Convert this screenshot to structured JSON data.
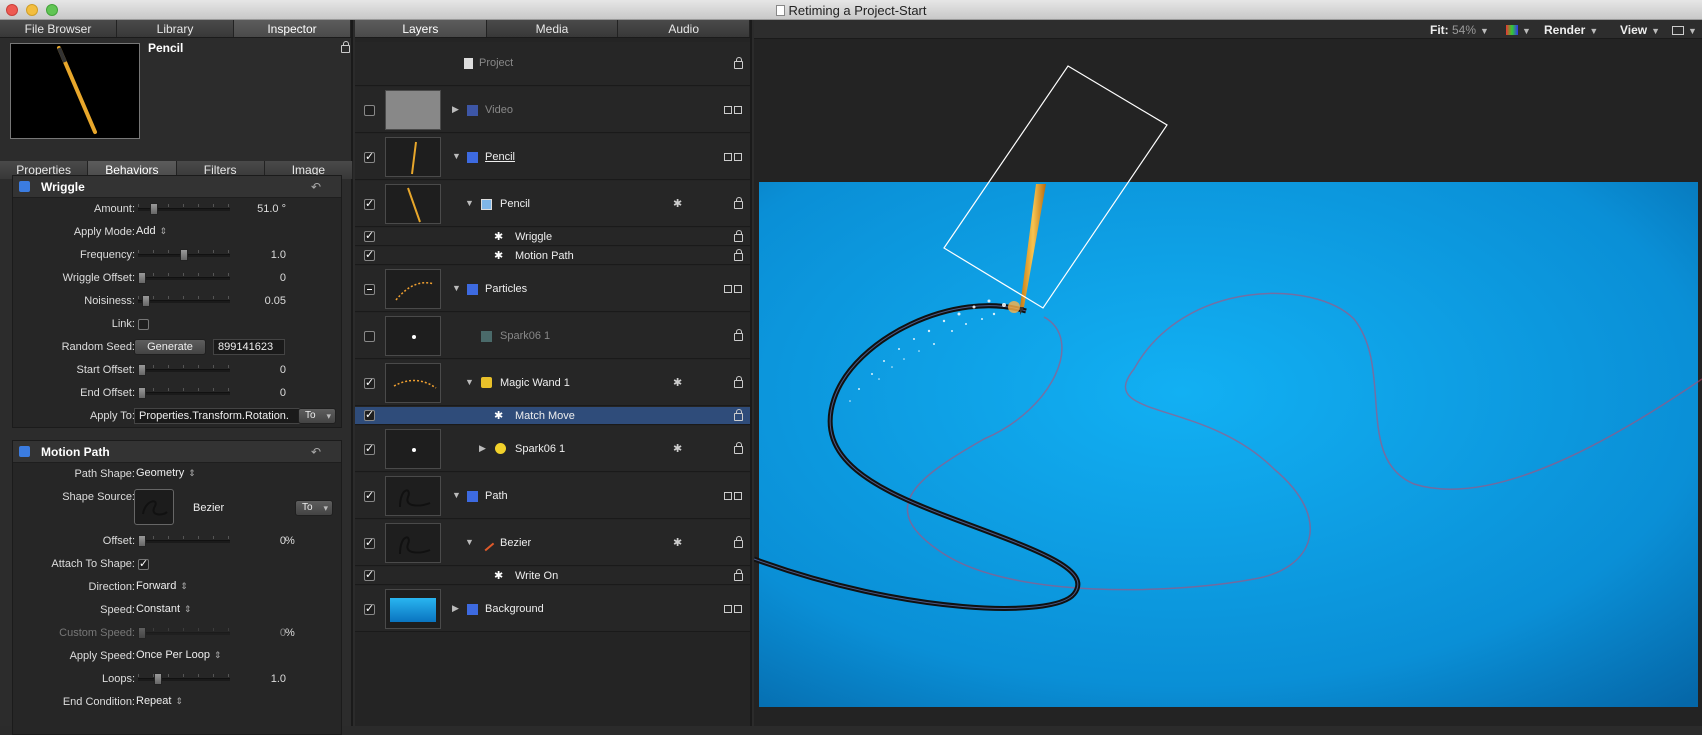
{
  "window": {
    "title": "Retiming a Project-Start"
  },
  "left_tabs": [
    "File Browser",
    "Library",
    "Inspector"
  ],
  "inspector": {
    "object_name": "Pencil",
    "subtabs": [
      "Properties",
      "Behaviors",
      "Filters",
      "Image"
    ],
    "wriggle": {
      "title": "Wriggle",
      "amount_label": "Amount:",
      "amount_value": "51.0 °",
      "amount_fraction": 0.15,
      "apply_mode_label": "Apply Mode:",
      "apply_mode_value": "Add",
      "frequency_label": "Frequency:",
      "frequency_value": "1.0",
      "frequency_fraction": 0.47,
      "offset_label": "Wriggle Offset:",
      "offset_value": "0",
      "noisiness_label": "Noisiness:",
      "noisiness_value": "0.05",
      "noisiness_fraction": 0.05,
      "link_label": "Link:",
      "seed_label": "Random Seed:",
      "generate_label": "Generate",
      "seed_value": "899141623",
      "start_offset_label": "Start Offset:",
      "start_offset_value": "0",
      "end_offset_label": "End Offset:",
      "end_offset_value": "0",
      "apply_to_label": "Apply To:",
      "apply_to_value": "Properties.Transform.Rotation.",
      "apply_to_btn": "To"
    },
    "motion_path": {
      "title": "Motion Path",
      "path_shape_label": "Path Shape:",
      "path_shape_value": "Geometry",
      "shape_source_label": "Shape Source:",
      "shape_source_value": "Bezier",
      "shape_source_btn": "To",
      "offset_label": "Offset:",
      "offset_value": "0",
      "offset_unit": "%",
      "attach_label": "Attach To Shape:",
      "direction_label": "Direction:",
      "direction_value": "Forward",
      "speed_label": "Speed:",
      "speed_value": "Constant",
      "custom_speed_label": "Custom Speed:",
      "custom_speed_value": "0",
      "custom_speed_unit": "%",
      "apply_speed_label": "Apply Speed:",
      "apply_speed_value": "Once Per Loop",
      "loops_label": "Loops:",
      "loops_value": "1.0",
      "loops_fraction": 0.18,
      "end_condition_label": "End Condition:",
      "end_condition_value": "Repeat"
    }
  },
  "middle_tabs": [
    "Layers",
    "Media",
    "Audio"
  ],
  "layers": [
    {
      "name": "Project"
    },
    {
      "name": "Video"
    },
    {
      "name": "Pencil"
    },
    {
      "name": "Pencil"
    },
    {
      "name": "Wriggle"
    },
    {
      "name": "Motion Path"
    },
    {
      "name": "Particles"
    },
    {
      "name": "Spark06 1"
    },
    {
      "name": "Magic Wand 1"
    },
    {
      "name": "Match Move"
    },
    {
      "name": "Spark06 1"
    },
    {
      "name": "Path"
    },
    {
      "name": "Bezier"
    },
    {
      "name": "Write On"
    },
    {
      "name": "Background"
    }
  ],
  "canvas_toolbar": {
    "fit_label": "Fit:",
    "fit_value": "54%",
    "render_label": "Render",
    "view_label": "View"
  },
  "colors": {
    "accent": "#3b7ce0",
    "canvas_bg": "#0a9ae0",
    "selection": "#2f4c7a"
  }
}
